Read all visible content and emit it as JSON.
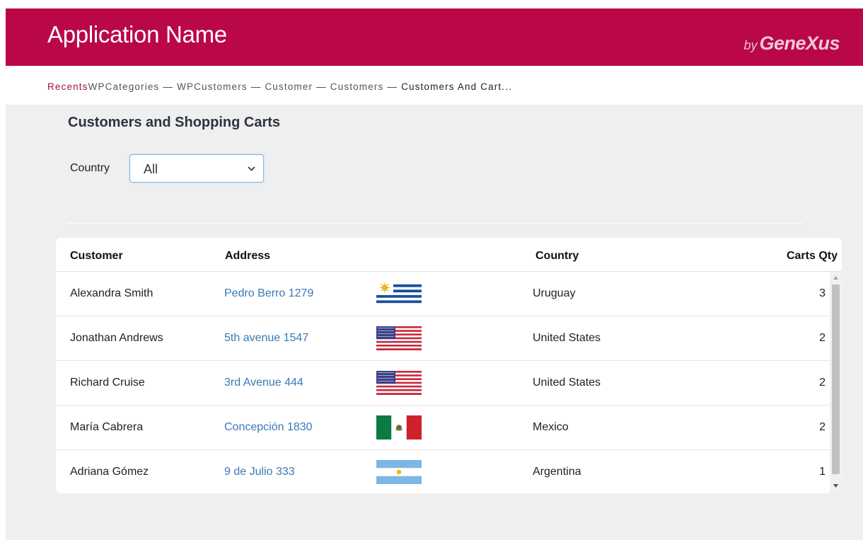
{
  "header": {
    "app_name": "Application Name",
    "brand_by": "by",
    "brand_name": "GeneXus",
    "background_color": "#ba0748"
  },
  "recents": {
    "label": "Recents",
    "items": [
      "WPCategories",
      "WPCustomers",
      "Customer",
      "Customers",
      "Customers And Cart..."
    ],
    "separator": "—"
  },
  "page": {
    "title": "Customers and Shopping Carts"
  },
  "filter": {
    "label": "Country",
    "selected": "All"
  },
  "grid": {
    "columns": {
      "customer": "Customer",
      "address": "Address",
      "country": "Country",
      "carts_qty": "Carts Qty"
    },
    "rows": [
      {
        "customer": "Alexandra Smith",
        "address": "Pedro Berro 1279",
        "flag": "uruguay-flag-icon",
        "country": "Uruguay",
        "carts_qty": "3"
      },
      {
        "customer": "Jonathan Andrews",
        "address": "5th avenue 1547",
        "flag": "usa-flag-icon",
        "country": "United States",
        "carts_qty": "2"
      },
      {
        "customer": "Richard Cruise",
        "address": "3rd Avenue 444",
        "flag": "usa-flag-icon",
        "country": "United States",
        "carts_qty": "2"
      },
      {
        "customer": "María Cabrera",
        "address": "Concepción 1830",
        "flag": "mexico-flag-icon",
        "country": "Mexico",
        "carts_qty": "2"
      },
      {
        "customer": "Adriana Gómez",
        "address": "9 de Julio 333",
        "flag": "argentina-flag-icon",
        "country": "Argentina",
        "carts_qty": "1"
      }
    ]
  }
}
